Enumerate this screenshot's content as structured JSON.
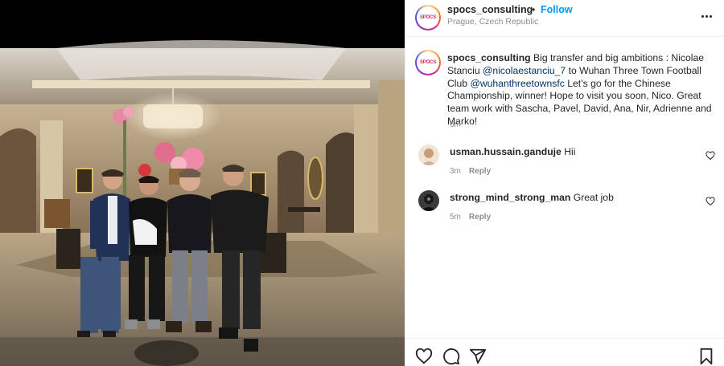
{
  "post": {
    "username": "spocs_consulting",
    "separator": "•",
    "follow_label": "Follow",
    "location": "Prague, Czech Republic",
    "avatar_logo_text": "SPOCS"
  },
  "caption": {
    "username": "spocs_consulting",
    "text_1": " Big transfer and big ambitions : Nicolae Stanciu ",
    "mention_1": "@nicolaestanciu_7",
    "text_2": " to Wuhan Three Town Football Club ",
    "mention_2": "@wuhanthreetownsfc",
    "text_3": " Let’s go for the Chinese Championship, winner! Hope to visit you soon, Nico. Great team work with Sascha, Pavel, David, Ana, Nir, Adrienne and Marko!",
    "time": "6m"
  },
  "comments": [
    {
      "username": "usman.hussain.ganduje",
      "text": " Hii",
      "time": "3m",
      "reply_label": "Reply"
    },
    {
      "username": "strong_mind_strong_man",
      "text": " Great job",
      "time": "5m",
      "reply_label": "Reply"
    }
  ],
  "icons": {
    "like": "heart-icon",
    "comment": "comment-icon",
    "share": "share-icon",
    "save": "bookmark-icon",
    "more": "more-options-icon"
  },
  "colors": {
    "accent": "#0095f6",
    "mention": "#00376b",
    "muted": "#8e8e8e",
    "text": "#262626"
  }
}
